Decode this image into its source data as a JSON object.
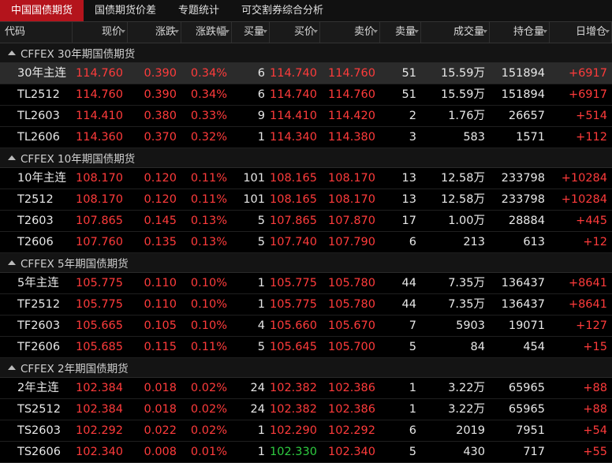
{
  "tabs": [
    "中国国债期货",
    "国债期货价差",
    "专题统计",
    "可交割券综合分析"
  ],
  "columns": [
    "代码",
    "现价",
    "涨跌",
    "涨跌幅",
    "买量",
    "买价",
    "卖价",
    "卖量",
    "成交量",
    "持仓量",
    "日增仓"
  ],
  "groups": [
    {
      "title": "CFFEX 30年期国债期货",
      "rows": [
        {
          "code": "30年主连",
          "price": "114.760",
          "chg": "0.390",
          "pct": "0.34%",
          "bidv": "6",
          "bid": "114.740",
          "ask": "114.760",
          "askv": "51",
          "vol": "15.59万",
          "oi": "151894",
          "doi": "+6917",
          "selected": true
        },
        {
          "code": "TL2512",
          "price": "114.760",
          "chg": "0.390",
          "pct": "0.34%",
          "bidv": "6",
          "bid": "114.740",
          "ask": "114.760",
          "askv": "51",
          "vol": "15.59万",
          "oi": "151894",
          "doi": "+6917"
        },
        {
          "code": "TL2603",
          "price": "114.410",
          "chg": "0.380",
          "pct": "0.33%",
          "bidv": "9",
          "bid": "114.410",
          "ask": "114.420",
          "askv": "2",
          "vol": "1.76万",
          "oi": "26657",
          "doi": "+514"
        },
        {
          "code": "TL2606",
          "price": "114.360",
          "chg": "0.370",
          "pct": "0.32%",
          "bidv": "1",
          "bid": "114.340",
          "ask": "114.380",
          "askv": "3",
          "vol": "583",
          "oi": "1571",
          "doi": "+112"
        }
      ]
    },
    {
      "title": "CFFEX 10年期国债期货",
      "rows": [
        {
          "code": "10年主连",
          "price": "108.170",
          "chg": "0.120",
          "pct": "0.11%",
          "bidv": "101",
          "bid": "108.165",
          "ask": "108.170",
          "askv": "13",
          "vol": "12.58万",
          "oi": "233798",
          "doi": "+10284"
        },
        {
          "code": "T2512",
          "price": "108.170",
          "chg": "0.120",
          "pct": "0.11%",
          "bidv": "101",
          "bid": "108.165",
          "ask": "108.170",
          "askv": "13",
          "vol": "12.58万",
          "oi": "233798",
          "doi": "+10284"
        },
        {
          "code": "T2603",
          "price": "107.865",
          "chg": "0.145",
          "pct": "0.13%",
          "bidv": "5",
          "bid": "107.865",
          "ask": "107.870",
          "askv": "17",
          "vol": "1.00万",
          "oi": "28884",
          "doi": "+445"
        },
        {
          "code": "T2606",
          "price": "107.760",
          "chg": "0.135",
          "pct": "0.13%",
          "bidv": "5",
          "bid": "107.740",
          "ask": "107.790",
          "askv": "6",
          "vol": "213",
          "oi": "613",
          "doi": "+12"
        }
      ]
    },
    {
      "title": "CFFEX 5年期国债期货",
      "rows": [
        {
          "code": "5年主连",
          "price": "105.775",
          "chg": "0.110",
          "pct": "0.10%",
          "bidv": "1",
          "bid": "105.775",
          "ask": "105.780",
          "askv": "44",
          "vol": "7.35万",
          "oi": "136437",
          "doi": "+8641"
        },
        {
          "code": "TF2512",
          "price": "105.775",
          "chg": "0.110",
          "pct": "0.10%",
          "bidv": "1",
          "bid": "105.775",
          "ask": "105.780",
          "askv": "44",
          "vol": "7.35万",
          "oi": "136437",
          "doi": "+8641"
        },
        {
          "code": "TF2603",
          "price": "105.665",
          "chg": "0.105",
          "pct": "0.10%",
          "bidv": "4",
          "bid": "105.660",
          "ask": "105.670",
          "askv": "7",
          "vol": "5903",
          "oi": "19071",
          "doi": "+127"
        },
        {
          "code": "TF2606",
          "price": "105.685",
          "chg": "0.115",
          "pct": "0.11%",
          "bidv": "5",
          "bid": "105.645",
          "ask": "105.700",
          "askv": "5",
          "vol": "84",
          "oi": "454",
          "doi": "+15"
        }
      ]
    },
    {
      "title": "CFFEX 2年期国债期货",
      "rows": [
        {
          "code": "2年主连",
          "price": "102.384",
          "chg": "0.018",
          "pct": "0.02%",
          "bidv": "24",
          "bid": "102.382",
          "ask": "102.386",
          "askv": "1",
          "vol": "3.22万",
          "oi": "65965",
          "doi": "+88"
        },
        {
          "code": "TS2512",
          "price": "102.384",
          "chg": "0.018",
          "pct": "0.02%",
          "bidv": "24",
          "bid": "102.382",
          "ask": "102.386",
          "askv": "1",
          "vol": "3.22万",
          "oi": "65965",
          "doi": "+88"
        },
        {
          "code": "TS2603",
          "price": "102.292",
          "chg": "0.022",
          "pct": "0.02%",
          "bidv": "1",
          "bid": "102.290",
          "ask": "102.292",
          "askv": "6",
          "vol": "2019",
          "oi": "7951",
          "doi": "+54"
        },
        {
          "code": "TS2606",
          "price": "102.340",
          "chg": "0.008",
          "pct": "0.01%",
          "bidv": "1",
          "bid": "102.330",
          "ask": "102.340",
          "askv": "5",
          "vol": "430",
          "oi": "717",
          "doi": "+55",
          "bid_color": "green"
        }
      ]
    }
  ],
  "colors": {
    "up": "#ff3b3b",
    "down": "#2ecc40",
    "tab_active": "#b4141c"
  }
}
